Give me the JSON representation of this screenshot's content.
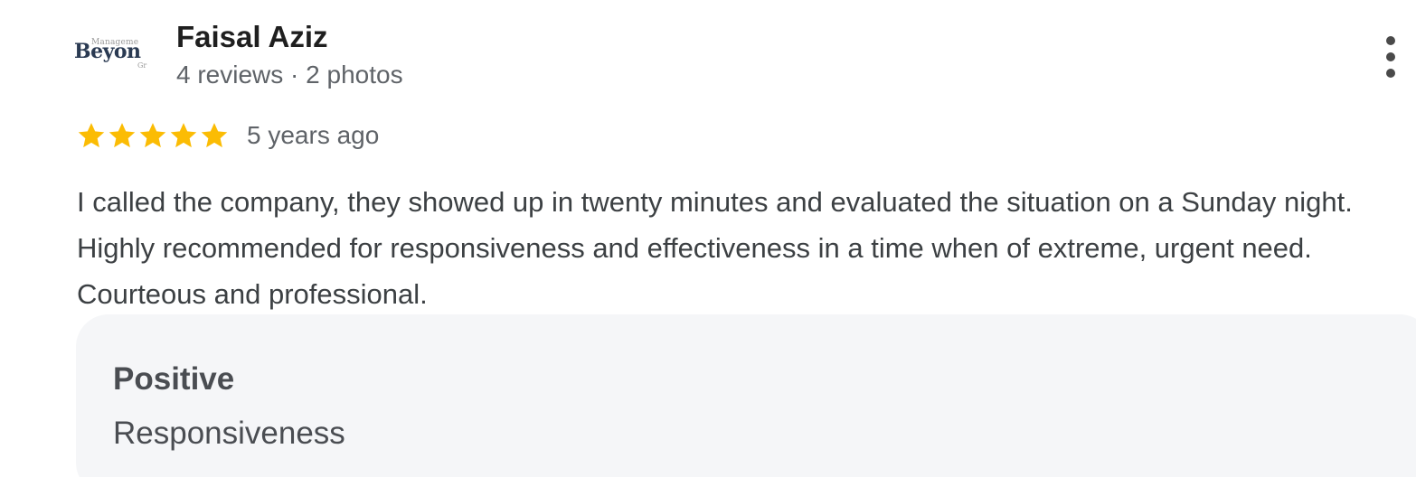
{
  "reviewer": {
    "avatar_logo": {
      "top": "Manageme",
      "main": "Beyon",
      "sub": "Gr"
    },
    "name": "Faisal Aziz",
    "meta": "4 reviews · 2 photos"
  },
  "menu_icon": "more-vertical-icon",
  "rating": {
    "stars": 5,
    "max": 5,
    "star_color": "#fbbc04",
    "time_ago": "5 years ago"
  },
  "review_text": "I called the company, they showed up in twenty minutes and evaluated the situation on a Sunday night. Highly recommended for responsiveness and effectiveness in a time when of extreme, urgent need. Courteous and professional.",
  "highlights": {
    "title": "Positive",
    "value": "Responsiveness"
  }
}
